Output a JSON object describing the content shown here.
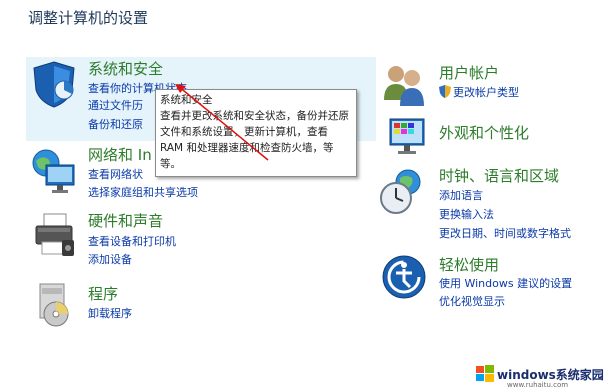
{
  "page_title": "调整计算机的设置",
  "left": [
    {
      "title": "系统和安全",
      "icon": "shield-icon",
      "links": [
        "查看你的计算机状态",
        "通过文件历",
        "备份和还原"
      ]
    },
    {
      "title": "网络和 In",
      "icon": "network-globe-icon",
      "links": [
        "查看网络状",
        "选择家庭组和共享选项"
      ]
    },
    {
      "title": "硬件和声音",
      "icon": "printer-icon",
      "links": [
        "查看设备和打印机",
        "添加设备"
      ]
    },
    {
      "title": "程序",
      "icon": "programs-disc-icon",
      "links": [
        "卸载程序"
      ]
    }
  ],
  "right": [
    {
      "title": "用户帐户",
      "icon": "users-icon",
      "links": [
        "更改帐户类型"
      ]
    },
    {
      "title": "外观和个性化",
      "icon": "monitor-palette-icon",
      "links": []
    },
    {
      "title": "时钟、语言和区域",
      "icon": "clock-globe-icon",
      "links": [
        "添加语言",
        "更换输入法",
        "更改日期、时间或数字格式"
      ]
    },
    {
      "title": "轻松使用",
      "icon": "ease-of-access-icon",
      "links": [
        "使用 Windows 建议的设置",
        "优化视觉显示"
      ]
    }
  ],
  "tooltip": {
    "title": "系统和安全",
    "body": "查看并更改系统和安全状态，备份并还原文件和系统设置，更新计算机，查看 RAM 和处理器速度和检查防火墙，等等。"
  },
  "watermark": {
    "brand": "windows系统家园",
    "url": "www.ruhaitu.com"
  }
}
